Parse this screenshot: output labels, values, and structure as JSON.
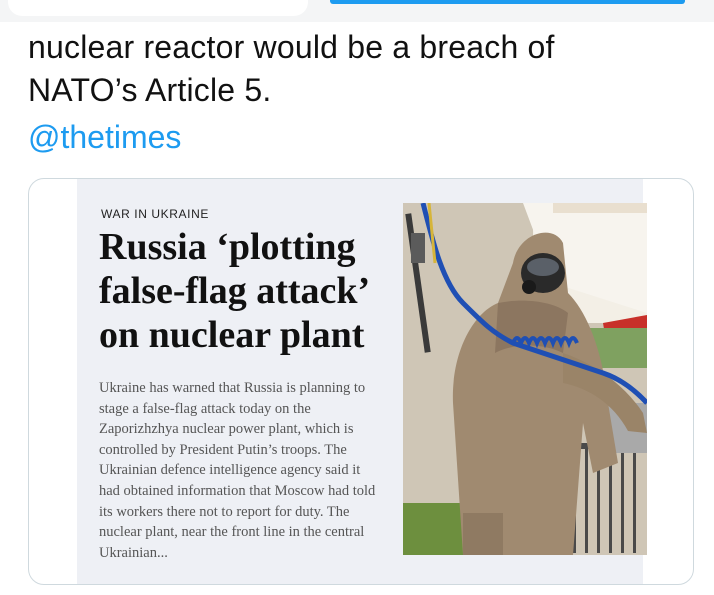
{
  "tweet": {
    "text_line1": "nuclear reactor would be a breach of",
    "text_line2": "NATO’s Article 5.",
    "mention": "@thetimes"
  },
  "card": {
    "kicker": "WAR IN UKRAINE",
    "headline_lines": [
      "Russia ‘plotting",
      "false-flag attack’",
      "on nuclear plant"
    ],
    "body_lines": [
      "Ukraine has warned that Russia is planning to",
      "stage a false-flag attack today on the",
      "Zaporizhzhya nuclear power plant, which is",
      "controlled by President Putin’s troops. The",
      "Ukrainian defence intelligence agency said it",
      "had obtained information that Moscow had told",
      "its workers there not to report for duty. The",
      "nuclear plant, near the front line in the central",
      "Ukrainian..."
    ],
    "photo": {
      "subject-icon": "hazmat-suit-photo",
      "colors": {
        "suit": "#a08a70",
        "hose": "#1f4fb4",
        "tent": "#f5f1ea",
        "stripe": "#c8302a"
      }
    }
  },
  "colors": {
    "mention": "#1d9bf0",
    "article_bg": "#eef0f5",
    "card_border": "#cfd9de"
  }
}
